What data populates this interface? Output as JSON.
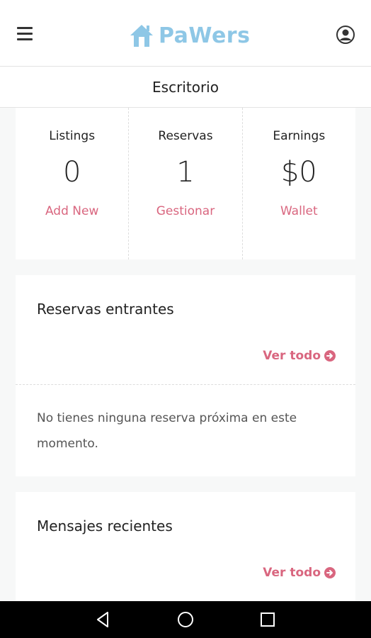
{
  "header": {
    "brand_name": "PaWers",
    "menu_icon": "hamburger-menu-icon",
    "profile_icon": "user-profile-icon",
    "brand_color": "#8ec7e6"
  },
  "subheader": {
    "title": "Escritorio"
  },
  "stats": [
    {
      "label": "Listings",
      "value": "0",
      "link": "Add New"
    },
    {
      "label": "Reservas",
      "value": "1",
      "link": "Gestionar"
    },
    {
      "label": "Earnings",
      "value": "$0",
      "link": "Wallet"
    }
  ],
  "upcoming": {
    "title": "Reservas entrantes",
    "view_all": "Ver todo",
    "empty_text": "No tienes ninguna reserva próxima en este momento."
  },
  "messages": {
    "title": "Mensajes recientes",
    "view_all": "Ver todo"
  },
  "colors": {
    "accent": "#d9667f",
    "background": "#f7f8f8"
  },
  "android_nav": {
    "back": "back-icon",
    "home": "home-icon",
    "recents": "recents-icon"
  }
}
